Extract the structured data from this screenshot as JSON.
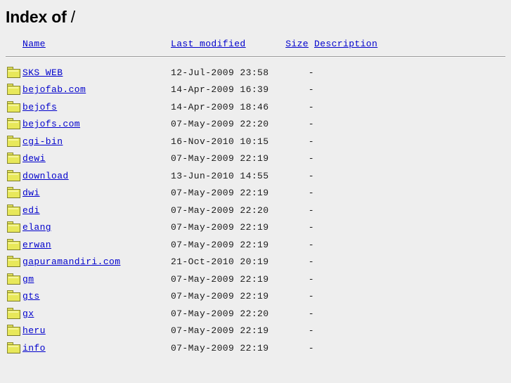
{
  "page": {
    "title_prefix": "Index of",
    "title_path": "/"
  },
  "columns": {
    "icon": "",
    "name": "Name",
    "last_modified": "Last modified",
    "size": "Size",
    "description": "Description"
  },
  "entries": [
    {
      "icon": "folder-icon",
      "name": "SKS_WEB",
      "last_modified": "12-Jul-2009 23:58",
      "size": "-",
      "description": ""
    },
    {
      "icon": "folder-icon",
      "name": "bejofab.com",
      "last_modified": "14-Apr-2009 16:39",
      "size": "-",
      "description": ""
    },
    {
      "icon": "folder-icon",
      "name": "bejofs",
      "last_modified": "14-Apr-2009 18:46",
      "size": "-",
      "description": ""
    },
    {
      "icon": "folder-icon",
      "name": "bejofs.com",
      "last_modified": "07-May-2009 22:20",
      "size": "-",
      "description": ""
    },
    {
      "icon": "folder-icon",
      "name": "cgi-bin",
      "last_modified": "16-Nov-2010 10:15",
      "size": "-",
      "description": ""
    },
    {
      "icon": "folder-icon",
      "name": "dewi",
      "last_modified": "07-May-2009 22:19",
      "size": "-",
      "description": ""
    },
    {
      "icon": "folder-icon",
      "name": "download",
      "last_modified": "13-Jun-2010 14:55",
      "size": "-",
      "description": ""
    },
    {
      "icon": "folder-icon",
      "name": "dwi",
      "last_modified": "07-May-2009 22:19",
      "size": "-",
      "description": ""
    },
    {
      "icon": "folder-icon",
      "name": "edi",
      "last_modified": "07-May-2009 22:20",
      "size": "-",
      "description": ""
    },
    {
      "icon": "folder-icon",
      "name": "elang",
      "last_modified": "07-May-2009 22:19",
      "size": "-",
      "description": ""
    },
    {
      "icon": "folder-icon",
      "name": "erwan",
      "last_modified": "07-May-2009 22:19",
      "size": "-",
      "description": ""
    },
    {
      "icon": "folder-icon",
      "name": "gapuramandiri.com",
      "last_modified": "21-Oct-2010 20:19",
      "size": "-",
      "description": ""
    },
    {
      "icon": "folder-icon",
      "name": "gm",
      "last_modified": "07-May-2009 22:19",
      "size": "-",
      "description": ""
    },
    {
      "icon": "folder-icon",
      "name": "gts",
      "last_modified": "07-May-2009 22:19",
      "size": "-",
      "description": ""
    },
    {
      "icon": "folder-icon",
      "name": "gx",
      "last_modified": "07-May-2009 22:20",
      "size": "-",
      "description": ""
    },
    {
      "icon": "folder-icon",
      "name": "heru",
      "last_modified": "07-May-2009 22:19",
      "size": "-",
      "description": ""
    },
    {
      "icon": "folder-icon",
      "name": "info",
      "last_modified": "07-May-2009 22:19",
      "size": "-",
      "description": ""
    }
  ],
  "colors": {
    "background": "#eeeeee",
    "link": "#0000cc",
    "text": "#000000",
    "rule": "#9a9a9a",
    "folder_fill": "#e8e85a",
    "folder_border": "#8a8a30"
  }
}
